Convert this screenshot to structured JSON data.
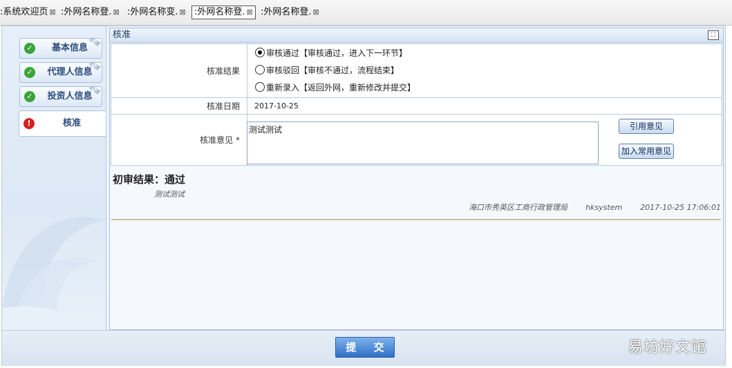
{
  "tabs": [
    {
      "label": ":系统欢迎页",
      "active": false
    },
    {
      "label": ":外网名称登.",
      "active": false
    },
    {
      "label": ":外网名称变.",
      "active": false
    },
    {
      "label": ":外网名称登.",
      "active": true
    },
    {
      "label": ":外网名称登.",
      "active": false
    }
  ],
  "tab_close_glyph": "⊠",
  "sidebar": {
    "steps": [
      {
        "label": "基本信息",
        "status": "done",
        "ribbon": "必填"
      },
      {
        "label": "代理人信息",
        "status": "done",
        "ribbon": "必填"
      },
      {
        "label": "投资人信息",
        "status": "done",
        "ribbon": "必填"
      },
      {
        "label": "核准",
        "status": "current"
      }
    ]
  },
  "panel": {
    "title": "核准",
    "result_label": "核准结果",
    "options": [
      {
        "text": "审核通过【审核通过，进入下一环节】",
        "checked": true
      },
      {
        "text": "审核驳回【审核不通过，流程结束】",
        "checked": false
      },
      {
        "text": "重新录入【返回外网，重新修改并提交】",
        "checked": false
      }
    ],
    "date_label": "核准日期",
    "date_value": "2017-10-25",
    "opinion_label": "核准意见 *",
    "opinion_value": "测试测试",
    "cite_button": "引用意见",
    "add_common_button": "加入常用意见"
  },
  "first_review": {
    "title": "初审结果：通过",
    "note": "测试测试",
    "office": "海口市秀英区工商行政管理局",
    "user": "hksystem",
    "time": "2017-10-25 17:06:01"
  },
  "footer": {
    "submit_label": "提 交"
  },
  "watermark": "易坊好文馆",
  "colors": {
    "accent": "#2f6fc6",
    "done": "#3aa43a",
    "current": "#d42020"
  }
}
